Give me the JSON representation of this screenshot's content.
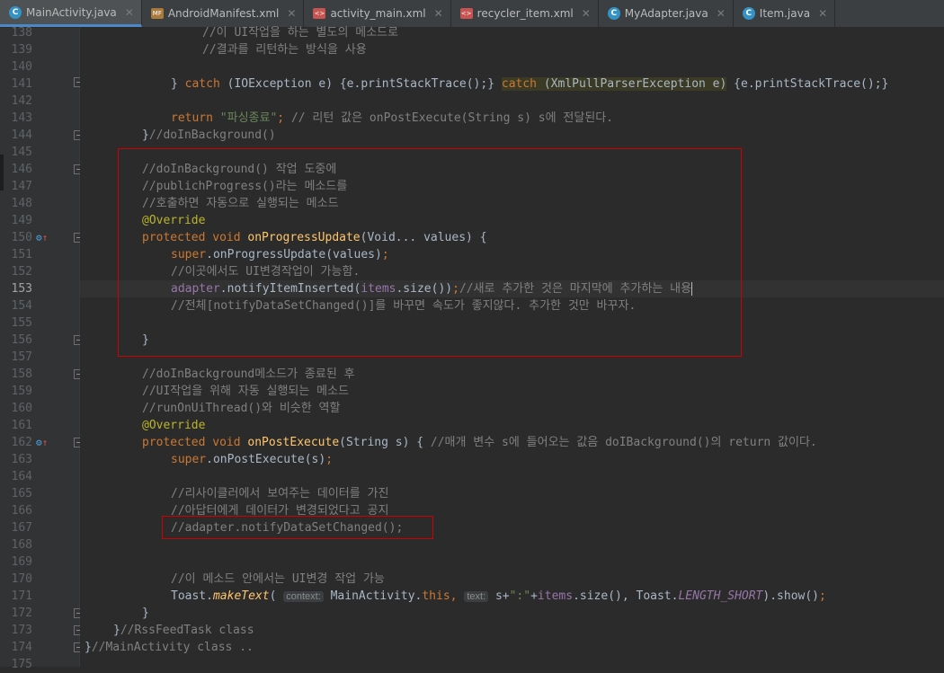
{
  "tabs": [
    {
      "label": "MainActivity.java",
      "icon": "class-icon",
      "active": true
    },
    {
      "label": "AndroidManifest.xml",
      "icon": "manifest-icon",
      "active": false
    },
    {
      "label": "activity_main.xml",
      "icon": "xml-icon",
      "active": false
    },
    {
      "label": "recycler_item.xml",
      "icon": "xml-icon",
      "active": false
    },
    {
      "label": "MyAdapter.java",
      "icon": "class-icon",
      "active": false
    },
    {
      "label": "Item.java",
      "icon": "class-icon",
      "active": false
    }
  ],
  "line_numbers": [
    "138",
    "139",
    "140",
    "141",
    "142",
    "143",
    "144",
    "145",
    "146",
    "147",
    "148",
    "149",
    "150",
    "151",
    "152",
    "153",
    "154",
    "155",
    "156",
    "157",
    "158",
    "159",
    "160",
    "161",
    "162",
    "163",
    "164",
    "165",
    "166",
    "167",
    "168",
    "169",
    "170",
    "171",
    "172",
    "173",
    "174",
    "175"
  ],
  "current_line": "153",
  "code": {
    "l138": "//이 UI작업을 하는 별도의 메소드로",
    "l139": "//결과를 리턴하는 방식을 사용",
    "l141a": "} ",
    "l141b": "catch",
    "l141c": " (IOException e) {e.printStackTrace();} ",
    "l141d": "catch",
    "l141e": " (XmlPullParserException e)",
    "l141f": " {e.printStackTrace();}",
    "l143a": "return ",
    "l143b": "\"파싱종료\"",
    "l143c": ";",
    "l143d": " // 리턴 값은 onPostExecute(String s) s에 전달된다.",
    "l144": "}//doInBackground()",
    "l146": "//doInBackground() 작업 도중에",
    "l147": "//publichProgress()라는 메소드를",
    "l148": "//호출하면 자동으로 실행되는 메소드",
    "l149": "@Override",
    "l150a": "protected void ",
    "l150b": "onProgressUpdate",
    "l150c": "(Void... values) {",
    "l151a": "super",
    "l151b": ".onProgressUpdate(values)",
    "l151c": ";",
    "l152": "//이곳에서도 UI변경작업이 가능함.",
    "l153a": "adapter",
    "l153b": ".notifyItemInserted(",
    "l153c": "items",
    "l153d": ".size())",
    "l153e": ";",
    "l153f": "//새로 추가한 것은 마지막에 추가하는 내용",
    "l154": "//전체[notifyDataSetChanged()]를 바꾸면 속도가 좋지않다. 추가한 것만 바꾸자.",
    "l156": "}",
    "l158": "//doInBackground메소드가 종료된 후",
    "l159": "//UI작업을 위해 자동 실행되는 메소드",
    "l160": "//runOnUiThread()와 비슷한 역할",
    "l161": "@Override",
    "l162a": "protected void ",
    "l162b": "onPostExecute",
    "l162c": "(String s) { ",
    "l162d": "//매개 변수 s에 들어오는 값음 doIBackground()의 return 값이다.",
    "l163a": "super",
    "l163b": ".onPostExecute(s)",
    "l163c": ";",
    "l166": "//리사이클러에서 보여주는 데이터를 가진",
    "l167": "//아답터에게 데이터가 변경되었다고 공지",
    "l168": "//adapter.notifyDataSetChanged();",
    "l170": "//이 메소드 안에서는 UI변경 작업 가능",
    "l171a": "Toast.",
    "l171b": "makeText",
    "l171c": "( ",
    "l171hint1": "context:",
    "l171d": " MainActivity.",
    "l171e": "this",
    "l171f": ", ",
    "l171hint2": "text:",
    "l171g": " s+",
    "l171h": "\":\"",
    "l171i": "+",
    "l171j": "items",
    "l171k": ".size(), Toast.",
    "l171l": "LENGTH_SHORT",
    "l171m": ").show()",
    "l171n": ";",
    "l172": "}",
    "l173": "}//RssFeedTask class",
    "l174": "}//MainActivity class .."
  },
  "colors": {
    "background": "#2b2b2b",
    "keyword": "#cc7832",
    "comment": "#808080",
    "string": "#6a8759",
    "annotation": "#bbb529",
    "method": "#ffc66d",
    "field": "#9876aa",
    "highlight_box": "#d00000"
  }
}
